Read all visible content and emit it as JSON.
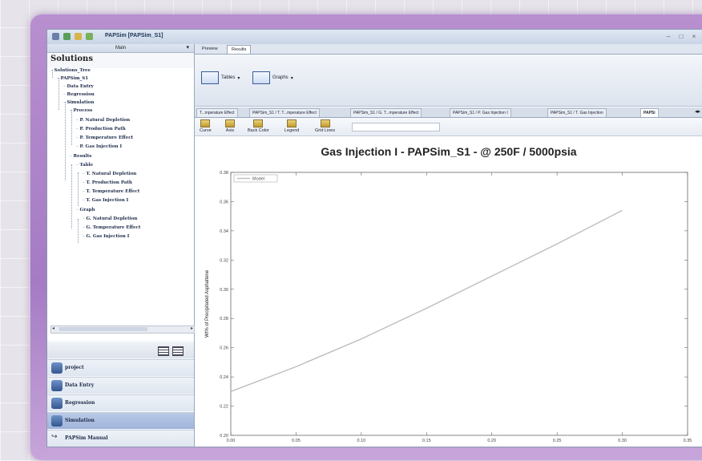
{
  "window": {
    "title": "PAPSim [PAPSim_S1]",
    "controls": [
      "–",
      "□",
      "×"
    ]
  },
  "left_panel": {
    "header": "Main",
    "pin": "▾",
    "title": "Solutions",
    "tree": [
      {
        "label": "Solutions_Tree",
        "level": 0
      },
      {
        "label": "PAPSim_S1",
        "level": 1
      },
      {
        "label": "Data Entry",
        "level": 2
      },
      {
        "label": "Regression",
        "level": 2
      },
      {
        "label": "Simulation",
        "level": 2
      },
      {
        "label": "Process",
        "level": 3
      },
      {
        "label": "P. Natural Depletion",
        "level": 4
      },
      {
        "label": "P. Production Path",
        "level": 4
      },
      {
        "label": "P. Temperature Effect",
        "level": 4
      },
      {
        "label": "P. Gas Injection I",
        "level": 4
      },
      {
        "label": "Results",
        "level": 3
      },
      {
        "label": "Table",
        "level": 4
      },
      {
        "label": "T. Natural Depletion",
        "level": 5
      },
      {
        "label": "T. Production Path",
        "level": 5
      },
      {
        "label": "T. Temperature Effect",
        "level": 5
      },
      {
        "label": "T. Gas Injection I",
        "level": 5
      },
      {
        "label": "Graph",
        "level": 4
      },
      {
        "label": "G. Natural Depletion",
        "level": 5
      },
      {
        "label": "G. Temperature Effect",
        "level": 5
      },
      {
        "label": "G. Gas Injection I",
        "level": 5
      }
    ],
    "nav": [
      {
        "label": "project",
        "selected": false
      },
      {
        "label": "Data Entry",
        "selected": false
      },
      {
        "label": "Regression",
        "selected": false
      },
      {
        "label": "Simulation",
        "selected": true
      },
      {
        "label": "PAPSim Manual",
        "selected": false
      }
    ]
  },
  "top_tabs": [
    {
      "label": "Preview",
      "active": false
    },
    {
      "label": "Results",
      "active": true
    }
  ],
  "ribbon": {
    "tables_label": "Tables",
    "graphs_label": "Graphs",
    "dropdown_glyph": "▾"
  },
  "doc_tabs": [
    {
      "label": "T...mperature Effect",
      "active": false
    },
    {
      "label": "PAPSim_S1 / T. T...mperature Effect",
      "active": false
    },
    {
      "label": "PAPSim_S1 / G. T...mperature Effect",
      "active": false
    },
    {
      "label": "PAPSim_S1 / P. Gas Injection I",
      "active": false
    },
    {
      "label": "PAPSim_S1 / T. Gas Injection",
      "active": false
    },
    {
      "label": "PAPSi",
      "active": true
    }
  ],
  "chart_toolbar": [
    "Curve",
    "Axis",
    "Back Color",
    "Legend",
    "Grid Lines"
  ],
  "chart_data": {
    "type": "line",
    "title": "Gas Injection I - PAPSim_S1 - @ 250F / 5000psia",
    "xlabel": "Injection Mole Ratio",
    "ylabel": "Wt% of Precipitated Asphaltene",
    "xlim": [
      0.0,
      0.35
    ],
    "ylim": [
      0.2,
      0.38
    ],
    "xticks": [
      "0.00",
      "0.05",
      "0.10",
      "0.15",
      "0.20",
      "0.25",
      "0.30",
      "0.35"
    ],
    "yticks": [
      "0.20",
      "0.22",
      "0.24",
      "0.26",
      "0.28",
      "0.30",
      "0.32",
      "0.34",
      "0.36",
      "0.38"
    ],
    "legend": "Model",
    "legend_position": "top-left",
    "grid": false,
    "series": [
      {
        "name": "Model",
        "color": "#bdbdbd",
        "x": [
          0.0,
          0.05,
          0.1,
          0.15,
          0.2,
          0.25,
          0.3
        ],
        "y": [
          0.23,
          0.247,
          0.266,
          0.287,
          0.309,
          0.331,
          0.354
        ]
      }
    ]
  }
}
